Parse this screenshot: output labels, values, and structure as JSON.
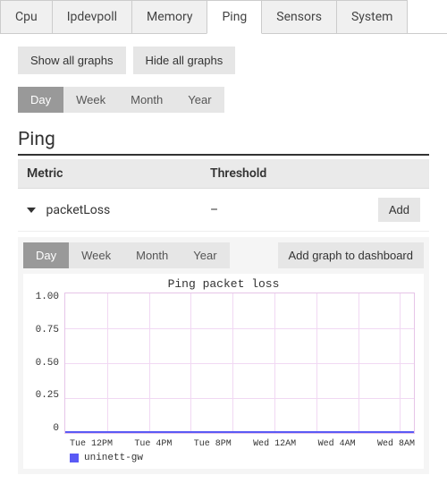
{
  "tabs": {
    "items": [
      {
        "label": "Cpu"
      },
      {
        "label": "Ipdevpoll"
      },
      {
        "label": "Memory"
      },
      {
        "label": "Ping"
      },
      {
        "label": "Sensors"
      },
      {
        "label": "System"
      }
    ],
    "active_index": 3
  },
  "buttons": {
    "show_all": "Show all graphs",
    "hide_all": "Hide all graphs",
    "add": "Add",
    "add_dashboard": "Add graph to dashboard"
  },
  "ranges": {
    "outer": [
      "Day",
      "Week",
      "Month",
      "Year"
    ],
    "outer_active": 0,
    "inner": [
      "Day",
      "Week",
      "Month",
      "Year"
    ],
    "inner_active": 0
  },
  "section": {
    "title": "Ping"
  },
  "table": {
    "head_metric": "Metric",
    "head_threshold": "Threshold",
    "rows": [
      {
        "metric": "packetLoss",
        "threshold": "–"
      }
    ]
  },
  "chart_data": {
    "type": "line",
    "title": "Ping packet loss",
    "ylabel": "",
    "xlabel": "",
    "ylim": [
      0,
      1.0
    ],
    "yticks": [
      "1.00",
      "0.75",
      "0.50",
      "0.25",
      "0"
    ],
    "xticks": [
      "Tue 12PM",
      "Tue 4PM",
      "Tue 8PM",
      "Wed 12AM",
      "Wed 4AM",
      "Wed 8AM"
    ],
    "series": [
      {
        "name": "uninett-gw",
        "color": "#5a5af5",
        "x": [
          "Tue 12PM",
          "Tue 4PM",
          "Tue 8PM",
          "Wed 12AM",
          "Wed 4AM",
          "Wed 8AM"
        ],
        "values": [
          0,
          0,
          0,
          0,
          0,
          0
        ]
      }
    ]
  }
}
